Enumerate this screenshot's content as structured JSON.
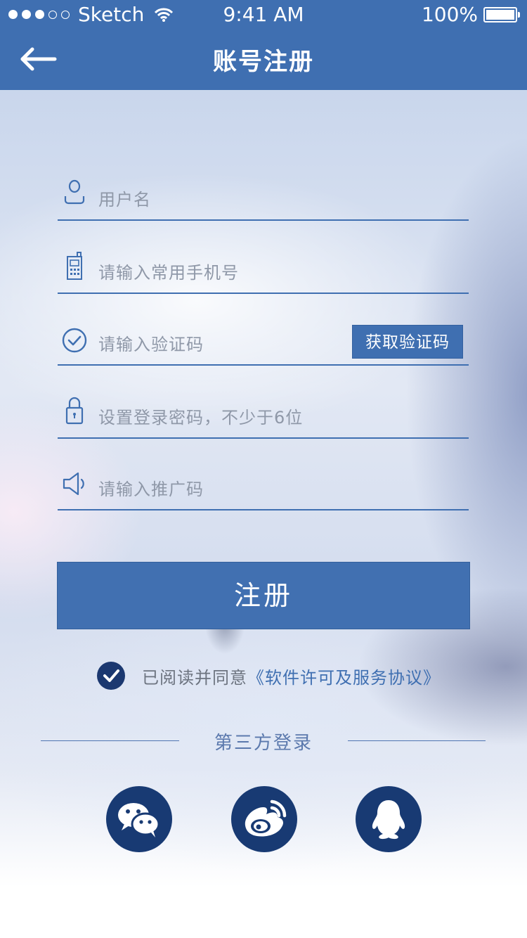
{
  "status_bar": {
    "carrier": "Sketch",
    "time": "9:41 AM",
    "battery": "100%"
  },
  "nav": {
    "title": "账号注册",
    "back_icon": "arrow-left-icon"
  },
  "form": {
    "username": {
      "placeholder": "用户名",
      "icon": "user-icon"
    },
    "phone": {
      "placeholder": "请输入常用手机号",
      "icon": "phone-icon"
    },
    "code": {
      "placeholder": "请输入验证码",
      "icon": "check-circle-icon",
      "button": "获取验证码"
    },
    "password": {
      "placeholder": "设置登录密码，不少于6位",
      "icon": "lock-icon"
    },
    "promo": {
      "placeholder": "请输入推广码",
      "icon": "speaker-icon"
    }
  },
  "register_button": "注册",
  "agreement": {
    "checked": true,
    "text": "已阅读并同意",
    "link": "《软件许可及服务协议》"
  },
  "third_party": {
    "label": "第三方登录",
    "icons": [
      "wechat-icon",
      "weibo-icon",
      "qq-icon"
    ]
  },
  "colors": {
    "primary": "#3f6fb1",
    "dark": "#183a73",
    "placeholder": "#8f98a8"
  }
}
